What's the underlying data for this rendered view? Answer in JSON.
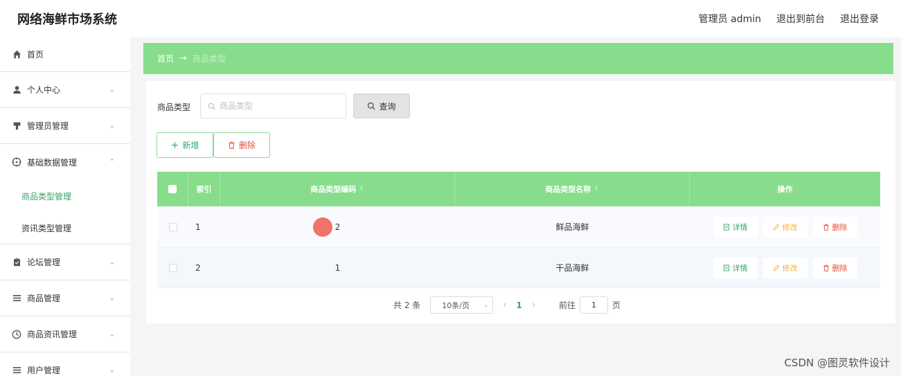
{
  "header": {
    "app_title": "网络海鲜市场系统",
    "admin_label": "管理员 admin",
    "front_link": "退出到前台",
    "logout_link": "退出登录"
  },
  "sidebar": {
    "items": [
      {
        "label": "首页",
        "icon": "home-icon"
      },
      {
        "label": "个人中心",
        "icon": "user-icon"
      },
      {
        "label": "管理员管理",
        "icon": "admin-icon"
      },
      {
        "label": "基础数据管理",
        "icon": "compass-icon"
      },
      {
        "label": "论坛管理",
        "icon": "clipboard-icon"
      },
      {
        "label": "商品管理",
        "icon": "list-icon"
      },
      {
        "label": "商品资讯管理",
        "icon": "clock-icon"
      },
      {
        "label": "用户管理",
        "icon": "list-icon"
      }
    ],
    "sub_items": [
      {
        "label": "商品类型管理",
        "active": true
      },
      {
        "label": "资讯类型管理",
        "active": false
      }
    ]
  },
  "breadcrumb": {
    "home": "首页",
    "separator": "→",
    "current": "商品类型"
  },
  "search": {
    "label": "商品类型",
    "placeholder": "商品类型",
    "button": "查询"
  },
  "actions": {
    "add": "新增",
    "delete": "删除"
  },
  "table": {
    "columns": [
      "索引",
      "商品类型编码",
      "商品类型名称",
      "操作"
    ],
    "rows": [
      {
        "index": "1",
        "code": "2",
        "name": "鲜品海鲜"
      },
      {
        "index": "2",
        "code": "1",
        "name": "干品海鲜"
      }
    ],
    "ops": {
      "detail": "详情",
      "edit": "修改",
      "delete": "删除"
    }
  },
  "pagination": {
    "total": "共 2 条",
    "page_size": "10条/页",
    "current": "1",
    "goto_prefix": "前往",
    "goto_value": "1",
    "goto_suffix": "页"
  },
  "watermark": "CSDN @图灵软件设计",
  "colors": {
    "accent": "#87dd8b",
    "primary_text": "#3aa36b",
    "warning": "#f0b045",
    "danger": "#e0533d"
  }
}
